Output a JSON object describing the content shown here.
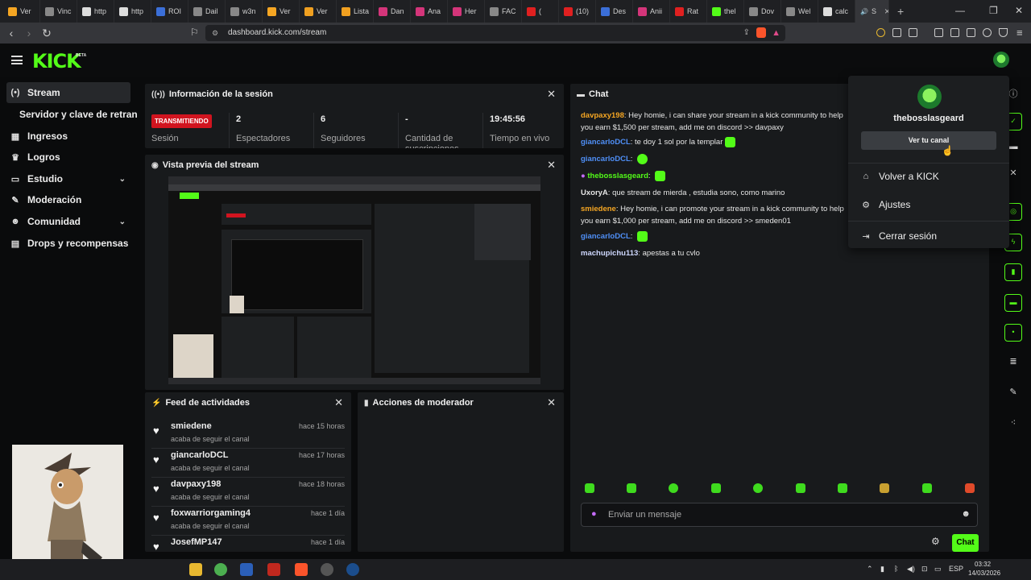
{
  "browser": {
    "tabs": [
      {
        "label": "Ver",
        "color": "#f5a623"
      },
      {
        "label": "Vinc",
        "color": "#888888"
      },
      {
        "label": "http",
        "color": "#dddddd"
      },
      {
        "label": "http",
        "color": "#dddddd"
      },
      {
        "label": "ROI",
        "color": "#3b6fd8"
      },
      {
        "label": "Dail",
        "color": "#888888"
      },
      {
        "label": "w3n",
        "color": "#888888"
      },
      {
        "label": "Ver",
        "color": "#f5a623"
      },
      {
        "label": "Ver",
        "color": "#f0a020"
      },
      {
        "label": "Lista",
        "color": "#f0a020"
      },
      {
        "label": "Dan",
        "color": "#d4357a"
      },
      {
        "label": "Ana",
        "color": "#d4357a"
      },
      {
        "label": "Her",
        "color": "#d4357a"
      },
      {
        "label": "FAC",
        "color": "#888888"
      },
      {
        "label": "(",
        "color": "#e02020"
      },
      {
        "label": "(10)",
        "color": "#e02020"
      },
      {
        "label": "Des",
        "color": "#3b6fd8"
      },
      {
        "label": "Anii",
        "color": "#d4357a"
      },
      {
        "label": "Rat",
        "color": "#e02020"
      },
      {
        "label": "thel",
        "color": "#53fc18"
      },
      {
        "label": "Dov",
        "color": "#888888"
      },
      {
        "label": "Wel",
        "color": "#888888"
      },
      {
        "label": "calc",
        "color": "#dddddd"
      }
    ],
    "active_tab": {
      "label": "S",
      "close": "×"
    },
    "new_tab": "+",
    "url": "dashboard.kick.com/stream"
  },
  "header": {
    "logo": "KICK",
    "beta": "BETA"
  },
  "sidebar": {
    "items": [
      {
        "label": "Stream",
        "icon": "(•)"
      },
      {
        "label": "Servidor y clave de retransmisión",
        "icon": ""
      },
      {
        "label": "Ingresos",
        "icon": "▦"
      },
      {
        "label": "Logros",
        "icon": "♛"
      },
      {
        "label": "Estudio",
        "icon": "▭"
      },
      {
        "label": "Moderación",
        "icon": "✎"
      },
      {
        "label": "Comunidad",
        "icon": "☻"
      },
      {
        "label": "Drops y recompensas",
        "icon": "▤"
      }
    ]
  },
  "session": {
    "title": "Información de la sesión",
    "badge": "TRANSMITIENDO",
    "stats": [
      {
        "value": "",
        "label": "Sesión"
      },
      {
        "value": "2",
        "label": "Espectadores"
      },
      {
        "value": "6",
        "label": "Seguidores"
      },
      {
        "value": "-",
        "label": "Cantidad de suscripciones"
      },
      {
        "value": "19:45:56",
        "label": "Tiempo en vivo"
      }
    ]
  },
  "preview": {
    "title": "Vista previa del stream"
  },
  "activity": {
    "title": "Feed de actividades",
    "items": [
      {
        "name": "smiedene",
        "sub": "acaba de seguir el canal",
        "time": "hace 15 horas"
      },
      {
        "name": "giancarloDCL",
        "sub": "acaba de seguir el canal",
        "time": "hace 17 horas"
      },
      {
        "name": "davpaxy198",
        "sub": "acaba de seguir el canal",
        "time": "hace 18 horas"
      },
      {
        "name": "foxwarriorgaming4",
        "sub": "acaba de seguir el canal",
        "time": "hace 1 día"
      },
      {
        "name": "JosefMP147",
        "sub": "",
        "time": "hace 1 día"
      }
    ]
  },
  "moderator": {
    "title": "Acciones de moderador"
  },
  "chat": {
    "title": "Chat",
    "messages": [
      {
        "user": "davpaxy198",
        "color": "#f5a623",
        "text": "Hey homie, i can share your stream in a kick community to help you earn $1,500 per stream, add me on discord >> davpaxy"
      },
      {
        "user": "giancarloDCL",
        "color": "#4f8ff7",
        "text": "te doy 1 sol por la templar"
      },
      {
        "user": "giancarloDCL",
        "color": "#4f8ff7",
        "text": ""
      },
      {
        "user": "thebosslasgeard",
        "color": "#53fc18",
        "text": ""
      },
      {
        "user": "UxoryA",
        "color": "#e6e6e6",
        "text": "que stream de mierda , estudia sono, como marino"
      },
      {
        "user": "smiedene",
        "color": "#f5a623",
        "text": "Hey homie, i can promote your stream in a kick community to help you earn $1,000 per stream, add me on discord >> smeden01"
      },
      {
        "user": "giancarloDCL",
        "color": "#4f8ff7",
        "text": ""
      },
      {
        "user": "machupichu113",
        "color": "#cfd8ff",
        "text": "apestas a tu cvlo"
      }
    ],
    "placeholder": "Enviar un mensaje",
    "send_label": "Chat"
  },
  "dropdown": {
    "username": "thebosslasgeard",
    "view_channel": "Ver tu canal",
    "items": [
      {
        "label": "Volver a KICK",
        "icon": "⌂"
      },
      {
        "label": "Ajustes",
        "icon": "⚙"
      },
      {
        "label": "Cerrar sesión",
        "icon": "⇥"
      }
    ]
  },
  "taskbar": {
    "lang": "ESP",
    "time": "03:32",
    "date": "14/03/2026"
  },
  "colors": {
    "accent": "#53fc18",
    "live": "#d1141f"
  }
}
